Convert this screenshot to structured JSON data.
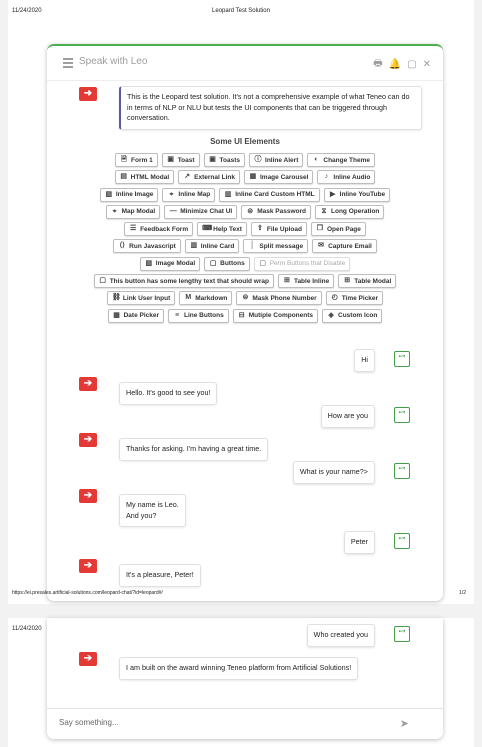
{
  "print": {
    "date": "11/24/2020",
    "title": "Leopard Test Solution",
    "url": "https://ei.presales.artificial-solutions.com/leopard-chat/?id=leopard#/",
    "page1": "1/2"
  },
  "chat": {
    "header_label": "Speak with Leo",
    "intro": "This is the Leopard test solution. It's not a comprehensive example of what Teneo can do in terms of NLP or NLU but tests the UI components that can be triggered through conversation.",
    "ui_heading": "Some UI Elements",
    "button_rows": [
      [
        {
          "label": "Form 1",
          "icon": "form-icon"
        },
        {
          "label": "Toast",
          "icon": "toast-icon"
        },
        {
          "label": "Toasts",
          "icon": "toasts-icon"
        },
        {
          "label": "Inline Alert",
          "icon": "alert-icon"
        },
        {
          "label": "Change Theme",
          "icon": "theme-icon"
        }
      ],
      [
        {
          "label": "HTML Modal",
          "icon": "html-icon"
        },
        {
          "label": "External Link",
          "icon": "external-link-icon"
        },
        {
          "label": "Image Carousel",
          "icon": "carousel-icon"
        },
        {
          "label": "Inline Audio",
          "icon": "audio-icon"
        }
      ],
      [
        {
          "label": "Inline Image",
          "icon": "image-icon"
        },
        {
          "label": "Inline Map",
          "icon": "map-pin-icon"
        },
        {
          "label": "Inline Card Custom HTML",
          "icon": "card-icon"
        },
        {
          "label": "Inline YouTube",
          "icon": "youtube-icon"
        }
      ],
      [
        {
          "label": "Map Modal",
          "icon": "map-pin-icon"
        },
        {
          "label": "Minimize Chat UI",
          "icon": "minimize-icon"
        },
        {
          "label": "Mask Password",
          "icon": "mask-icon"
        },
        {
          "label": "Long Operation",
          "icon": "hourglass-icon"
        }
      ],
      [
        {
          "label": "Feedback Form",
          "icon": "feedback-icon"
        },
        {
          "label": "Help Text",
          "icon": "help-icon"
        },
        {
          "label": "File Upload",
          "icon": "upload-icon"
        },
        {
          "label": "Open Page",
          "icon": "open-page-icon"
        }
      ],
      [
        {
          "label": "Run Javascript",
          "icon": "code-icon"
        },
        {
          "label": "Inline Card",
          "icon": "card-icon"
        },
        {
          "label": "Split message",
          "icon": "split-icon"
        },
        {
          "label": "Capture Email",
          "icon": "email-icon"
        }
      ],
      [
        {
          "label": "Image Modal",
          "icon": "image-modal-icon"
        },
        {
          "label": "Buttons",
          "icon": "buttons-icon"
        },
        {
          "label": "Perm Buttons that Disable",
          "icon": "buttons-icon",
          "disabled": true
        }
      ],
      [
        {
          "label": "This button has some lengthy text that should wrap",
          "icon": "buttons-icon"
        },
        {
          "label": "Table Inline",
          "icon": "table-icon"
        },
        {
          "label": "Table Modal",
          "icon": "table-icon"
        }
      ],
      [
        {
          "label": "Link User Input",
          "icon": "link-icon"
        },
        {
          "label": "Markdown",
          "icon": "markdown-icon"
        },
        {
          "label": "Mask Phone Number",
          "icon": "mask-icon"
        },
        {
          "label": "Time Picker",
          "icon": "clock-icon"
        }
      ],
      [
        {
          "label": "Date Picker",
          "icon": "calendar-icon"
        },
        {
          "label": "Line Buttons",
          "icon": "list-icon"
        },
        {
          "label": "Mutiple Components",
          "icon": "components-icon"
        },
        {
          "label": "Custom Icon",
          "icon": "tag-icon"
        }
      ]
    ],
    "messages_page1": [
      {
        "from": "user",
        "text": "Hi"
      },
      {
        "from": "bot",
        "text": "Hello. It's good to see you!"
      },
      {
        "from": "user",
        "text": "How are you"
      },
      {
        "from": "bot",
        "text": "Thanks for asking. I'm having a great time."
      },
      {
        "from": "user",
        "text": "What is your name?>"
      },
      {
        "from": "bot",
        "text": "My name is Leo.\nAnd you?"
      },
      {
        "from": "user",
        "text": "Peter"
      },
      {
        "from": "bot",
        "text": "It's a pleasure, Peter!"
      }
    ],
    "messages_page2": [
      {
        "from": "user",
        "text": "Who created you"
      },
      {
        "from": "bot",
        "text": "I am built on the award winning Teneo platform from Artificial Solutions!"
      }
    ],
    "input_placeholder": "Say something...",
    "colors": {
      "accent": "#4caf50",
      "bot_avatar": "#e53935",
      "intro_border": "#5c57a8",
      "bell": "#ff3d00"
    }
  }
}
